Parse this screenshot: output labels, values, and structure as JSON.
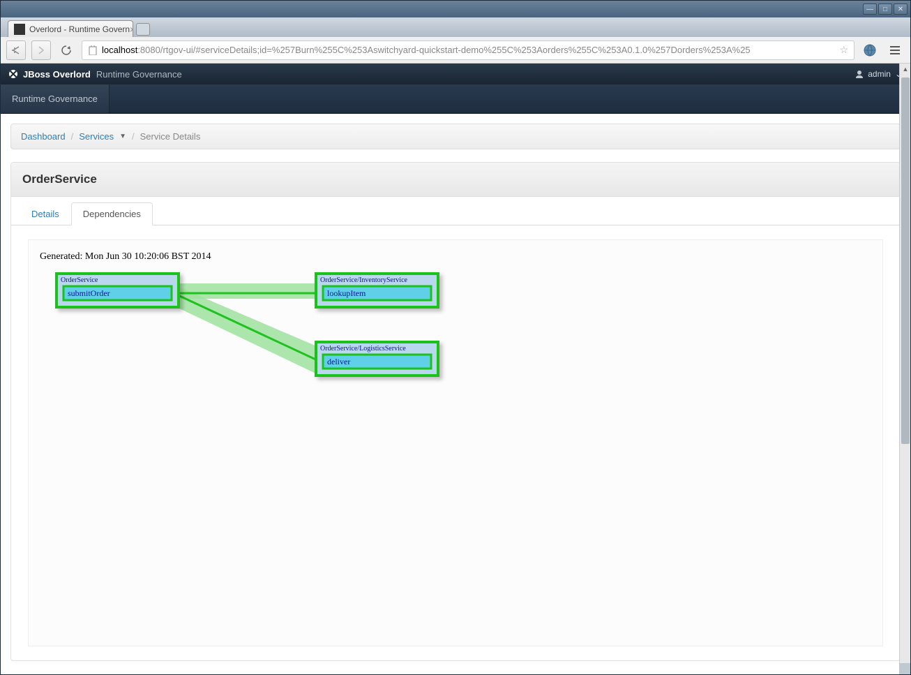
{
  "window": {
    "title": "Overlord - Runtime Govern"
  },
  "browser": {
    "url_host": "localhost",
    "url_path": ":8080/rtgov-ui/#serviceDetails;id=%257Burn%255C%253Aswitchyard-quickstart-demo%255C%253Aorders%255C%253A0.1.0%257Dorders%253A%25",
    "tab_title": "Overlord - Runtime Govern"
  },
  "app": {
    "brand": "JBoss Overlord",
    "subtitle": "Runtime Governance",
    "user": "admin"
  },
  "nav": {
    "runtime_governance": "Runtime Governance"
  },
  "breadcrumb": {
    "dashboard": "Dashboard",
    "services": "Services",
    "current": "Service Details"
  },
  "panel": {
    "title": "OrderService"
  },
  "tabs": {
    "details": "Details",
    "dependencies": "Dependencies"
  },
  "diagram": {
    "generated": "Generated: Mon Jun 30 10:20:06 BST 2014",
    "nodes": [
      {
        "service": "OrderService",
        "operation": "submitOrder"
      },
      {
        "service": "OrderService/InventoryService",
        "operation": "lookupItem"
      },
      {
        "service": "OrderService/LogisticsService",
        "operation": "deliver"
      }
    ]
  }
}
